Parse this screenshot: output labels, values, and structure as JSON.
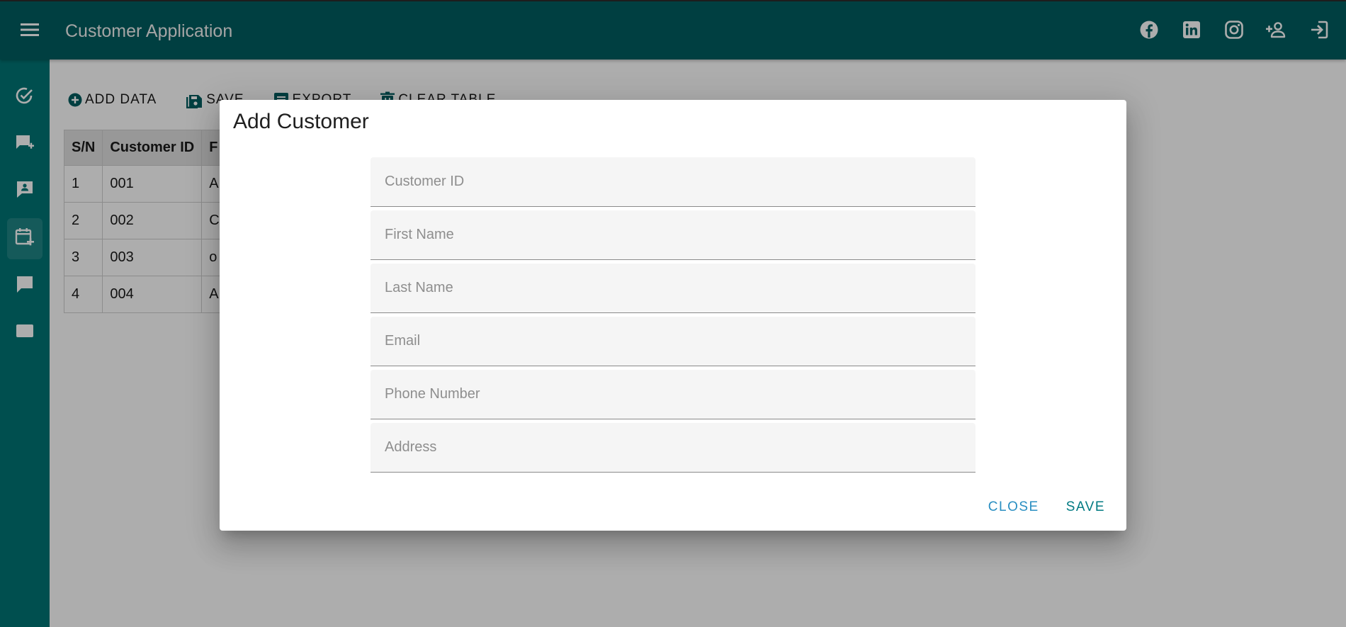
{
  "colors": {
    "primary": "#015E60",
    "rail": "#007575",
    "close_button": "#2A8FC2",
    "save_button": "#017A82"
  },
  "appbar": {
    "menu_icon": "menu-icon",
    "title": "Customer Application",
    "actions": [
      {
        "icon": "facebook-icon"
      },
      {
        "icon": "linkedin-icon"
      },
      {
        "icon": "instagram-icon"
      },
      {
        "icon": "add-person-icon"
      },
      {
        "icon": "logout-icon"
      }
    ]
  },
  "siderail": {
    "items": [
      {
        "icon": "task-check-icon",
        "active": false
      },
      {
        "icon": "add-message-icon",
        "active": false
      },
      {
        "icon": "contact-card-icon",
        "active": false
      },
      {
        "icon": "calendar-add-icon",
        "active": true
      },
      {
        "icon": "comment-icon",
        "active": false
      },
      {
        "icon": "card-icon",
        "active": false
      }
    ]
  },
  "toolbar": {
    "add_data": "ADD DATA",
    "save": "SAVE",
    "export": "EXPORT",
    "clear_table": "CLEAR TABLE"
  },
  "table": {
    "headers": [
      "S/N",
      "Customer ID",
      "F"
    ],
    "rows": [
      [
        "1",
        "001",
        "A"
      ],
      [
        "2",
        "002",
        "C"
      ],
      [
        "3",
        "003",
        "o"
      ],
      [
        "4",
        "004",
        "A"
      ]
    ]
  },
  "dialog": {
    "title": "Add Customer",
    "fields": {
      "customer_id": "Customer ID",
      "first_name": "First Name",
      "last_name": "Last Name",
      "email": "Email",
      "phone_number": "Phone Number",
      "address": "Address"
    },
    "close_label": "CLOSE",
    "save_label": "SAVE"
  }
}
